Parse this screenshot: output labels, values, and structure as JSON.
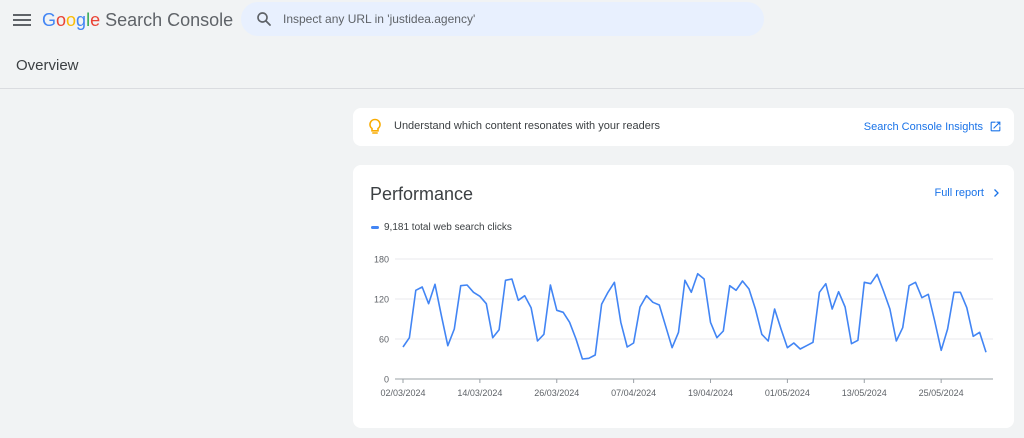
{
  "app": {
    "logo_letters": [
      "G",
      "o",
      "o",
      "g",
      "l",
      "e"
    ],
    "product_name": "Search Console"
  },
  "search": {
    "placeholder": "Inspect any URL in 'justidea.agency'"
  },
  "page": {
    "title": "Overview"
  },
  "insight_card": {
    "text": "Understand which content resonates with your readers",
    "link_label": "Search Console Insights"
  },
  "performance": {
    "title": "Performance",
    "full_report_label": "Full report",
    "legend_label": "9,181 total web search clicks"
  },
  "colors": {
    "accent": "#1a73e8",
    "series": "#4285f4",
    "search_bg": "#e8f0fe",
    "bulb": "#f9ab00"
  },
  "icons": {
    "menu": "menu-icon",
    "search": "search-icon",
    "insight": "lightbulb-icon",
    "external": "open-in-new-icon",
    "chevron": "chevron-right-icon"
  },
  "chart_data": {
    "type": "line",
    "ylim": [
      0,
      180
    ],
    "yticks": [
      0,
      60,
      120,
      180
    ],
    "xtick_labels": [
      "02/03/2024",
      "14/03/2024",
      "26/03/2024",
      "07/04/2024",
      "19/04/2024",
      "01/05/2024",
      "13/05/2024",
      "25/05/2024"
    ],
    "xtick_index": [
      0,
      12,
      24,
      36,
      48,
      60,
      72,
      84
    ],
    "series": [
      {
        "values": [
          48,
          62,
          133,
          138,
          113,
          142,
          95,
          50,
          75,
          140,
          141,
          130,
          124,
          113,
          62,
          74,
          148,
          150,
          118,
          125,
          107,
          57,
          67,
          141,
          103,
          100,
          85,
          60,
          30,
          31,
          36,
          112,
          130,
          145,
          85,
          48,
          54,
          108,
          125,
          115,
          111,
          79,
          47,
          70,
          148,
          130,
          158,
          150,
          85,
          62,
          72,
          140,
          133,
          147,
          135,
          105,
          67,
          57,
          105,
          75,
          47,
          54,
          45,
          50,
          55,
          130,
          143,
          105,
          131,
          108,
          53,
          58,
          145,
          143,
          157,
          132,
          105,
          57,
          77,
          140,
          145,
          122,
          127,
          87,
          43,
          75,
          130,
          130,
          107,
          64,
          70,
          40
        ]
      }
    ]
  }
}
